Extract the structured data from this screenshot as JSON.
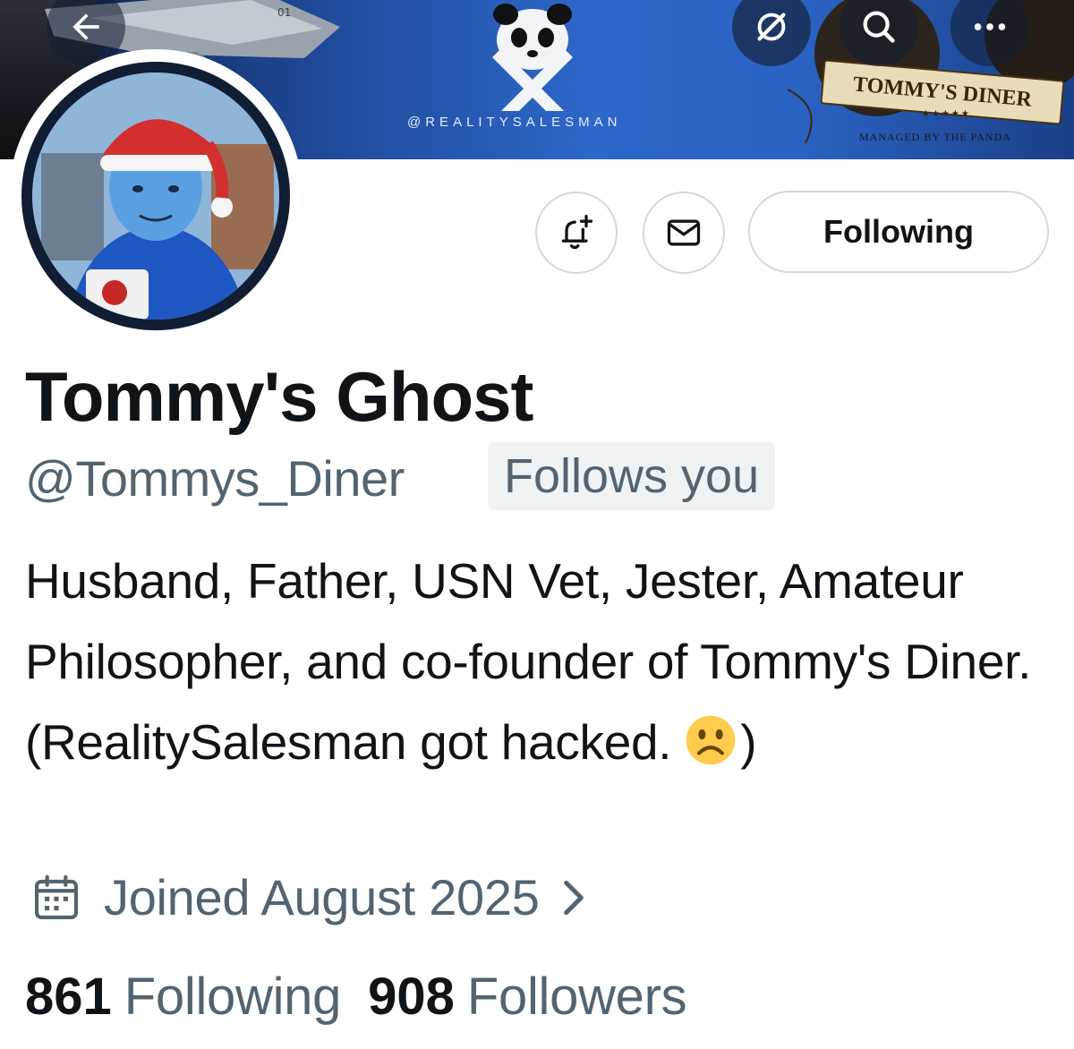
{
  "banner": {
    "handle_text": "@REALITYSALESMAN",
    "sign_text": "TOMMY'S DINER",
    "sign_stars": "★★★★★",
    "sign_subtitle": "MANAGED BY THE PANDA"
  },
  "topbar": {
    "back_icon": "arrow-left-icon",
    "grok_icon": "grok-icon",
    "search_icon": "search-icon",
    "more_icon": "more-icon"
  },
  "actions": {
    "notify_icon": "bell-plus-icon",
    "message_icon": "envelope-icon",
    "following_label": "Following"
  },
  "profile": {
    "display_name": "Tommy's Ghost",
    "handle": "@Tommys_Diner",
    "follows_you": "Follows you",
    "bio_text": "Husband, Father, USN Vet, Jester, Amateur Philosopher, and co-founder of Tommy's Diner. (RealitySalesman got hacked. ",
    "bio_emoji": "frowning-face-emoji",
    "bio_end": ")",
    "joined": "Joined August 2025",
    "following_count": "861",
    "following_label": "Following",
    "followers_count": "908",
    "followers_label": "Followers"
  },
  "colors": {
    "text_primary": "#0f1419",
    "text_secondary": "#536471",
    "border": "#cfd9de",
    "badge_bg": "#eff3f4",
    "banner_blue": "#2d67c9"
  }
}
